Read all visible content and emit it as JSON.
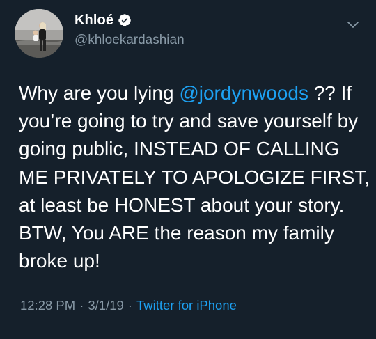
{
  "user": {
    "display_name": "Khloé",
    "handle": "@khloekardashian",
    "verified": true
  },
  "tweet": {
    "lines": [
      [
        {
          "text": "Why are you lying "
        },
        {
          "text": "@jordynwoods",
          "mention": true
        },
        {
          "text": " ?? If"
        }
      ],
      [
        {
          "text": "you’re going to try and save yourself by"
        }
      ],
      [
        {
          "text": "going public, INSTEAD OF CALLING"
        }
      ],
      [
        {
          "text": "ME PRIVATELY TO APOLOGIZE FIRST,"
        }
      ],
      [
        {
          "text": "at least be HONEST about your story."
        }
      ],
      [
        {
          "text": "BTW, You ARE the reason my family"
        }
      ],
      [
        {
          "text": "broke up!"
        }
      ]
    ]
  },
  "meta": {
    "time": "12:28 PM",
    "separator": "·",
    "date": "3/1/19",
    "source": "Twitter for iPhone"
  },
  "icons": {
    "verified": "verified-badge-icon",
    "menu": "chevron-down-icon"
  },
  "colors": {
    "background": "#15202b",
    "text": "#ffffff",
    "secondary_text": "#8899a6",
    "link": "#1da1f2",
    "divider": "#38444d"
  }
}
